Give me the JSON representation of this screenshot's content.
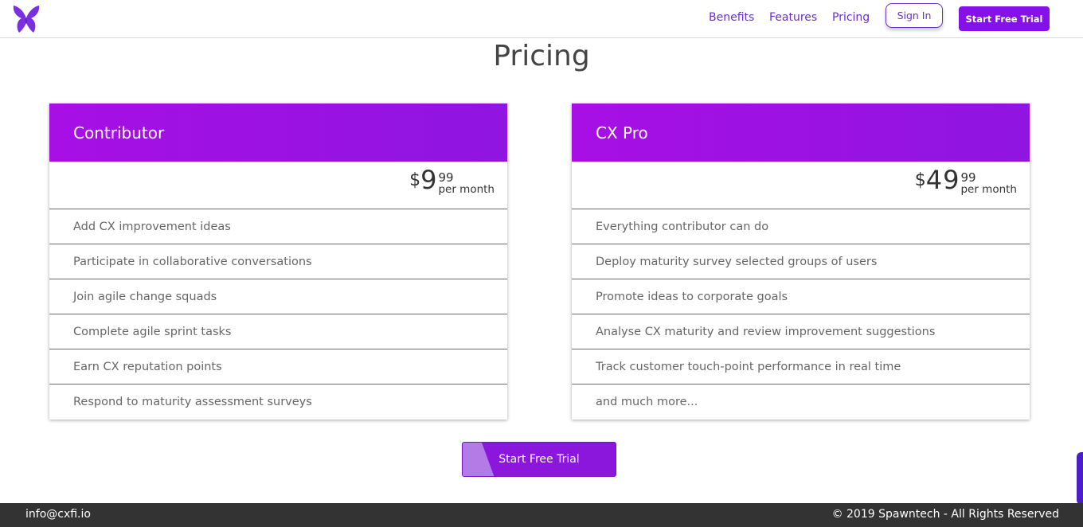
{
  "header": {
    "nav": [
      {
        "label": "Benefits"
      },
      {
        "label": "Features"
      },
      {
        "label": "Pricing"
      }
    ],
    "sign_in_label": "Sign In",
    "trial_label": "Start Free Trial",
    "logo_icon": "butterfly-logo-icon"
  },
  "page": {
    "title": "Pricing"
  },
  "plans": [
    {
      "name": "Contributor",
      "currency": "$",
      "amount": "9",
      "cents": "99",
      "period": "per month",
      "features": [
        "Add CX improvement ideas",
        "Participate in collaborative conversations",
        "Join agile change squads",
        "Complete agile sprint tasks",
        "Earn CX reputation points",
        "Respond to maturity assessment surveys"
      ]
    },
    {
      "name": "CX Pro",
      "currency": "$",
      "amount": "49",
      "cents": "99",
      "period": "per month",
      "features": [
        "Everything contributor can do",
        "Deploy maturity survey selected groups of users",
        "Promote ideas to corporate goals",
        "Analyse CX maturity and review improvement suggestions",
        "Track customer touch-point performance in real time",
        "and much more..."
      ]
    }
  ],
  "cta": {
    "label": "Start Free Trial"
  },
  "footer": {
    "email": "info@cxfi.io",
    "copyright": "© 2019 Spawntech - All Rights Reserved"
  },
  "colors": {
    "brand_purple": "#8610e8",
    "card_header": "#a70fe5",
    "footer_bg": "#333333"
  }
}
